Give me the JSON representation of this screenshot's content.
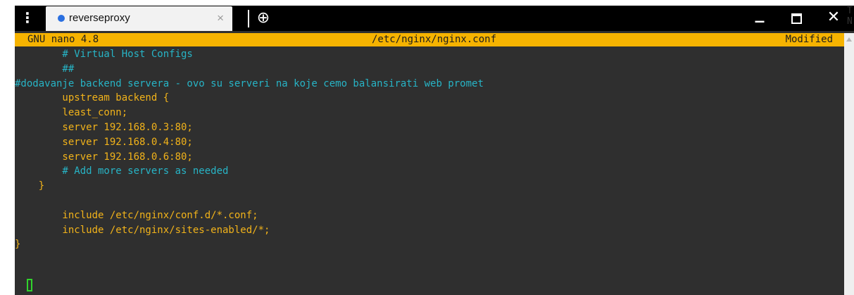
{
  "titlebar": {
    "menu_glyph": "⋮",
    "tab_title": "reverseproxy",
    "tab_close_glyph": "×",
    "new_tab_glyph": "⊕",
    "minimize_glyph": "_",
    "close_glyph": "✕"
  },
  "edge_text": "T\nN",
  "nano": {
    "version": "GNU nano 4.8",
    "filename": "/etc/nginx/nginx.conf",
    "status": "Modified"
  },
  "editor": {
    "lines": [
      {
        "text": "        # Virtual Host Configs",
        "style": "comment"
      },
      {
        "text": "        ##",
        "style": "comment"
      },
      {
        "text": "#dodavanje backend servera - ovo su serveri na koje cemo balansirati web promet",
        "style": "comment"
      },
      {
        "text": "        upstream backend {",
        "style": "code"
      },
      {
        "text": "        least_conn;",
        "style": "code"
      },
      {
        "text": "        server 192.168.0.3:80;",
        "style": "code"
      },
      {
        "text": "        server 192.168.0.4:80;",
        "style": "code"
      },
      {
        "text": "        server 192.168.0.6:80;",
        "style": "code"
      },
      {
        "text": "        # Add more servers as needed",
        "style": "comment"
      },
      {
        "text": "    }",
        "style": "code"
      },
      {
        "text": "",
        "style": "code"
      },
      {
        "text": "        include /etc/nginx/conf.d/*.conf;",
        "style": "code"
      },
      {
        "text": "        include /etc/nginx/sites-enabled/*;",
        "style": "code"
      },
      {
        "text": "}",
        "style": "code"
      }
    ]
  },
  "colors": {
    "header_bg": "#f6b300",
    "editor_bg": "#2f2f2f",
    "comment": "#27b4c6",
    "code": "#f2b31a",
    "cursor": "#31d32c",
    "tab_dot": "#2a6fe0"
  }
}
